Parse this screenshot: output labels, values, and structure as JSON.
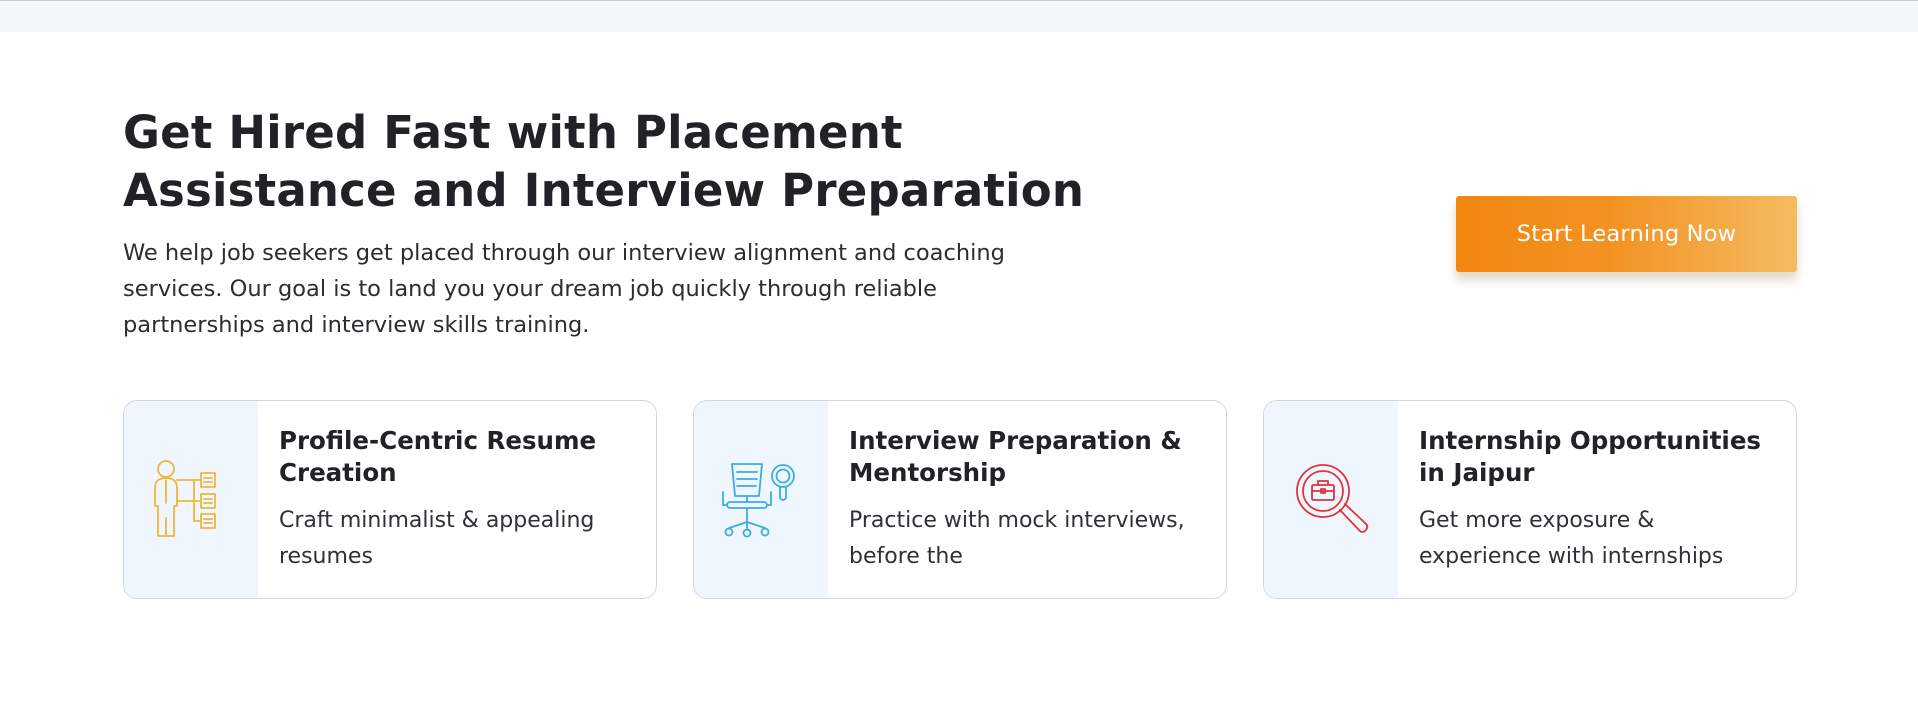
{
  "hero": {
    "title_line1": "Get Hired Fast with Placement",
    "title_line2": "Assistance and Interview Preparation",
    "description": "We help job seekers get placed through our interview alignment and coaching services. Our goal is to land you your dream job quickly through reliable partnerships and interview skills training."
  },
  "cta": {
    "label": "Start Learning Now",
    "gradient_start": "#f28710",
    "gradient_end": "#f4bb61"
  },
  "cards": [
    {
      "title": "Profile-Centric Resume Creation",
      "description": "Craft minimalist & appealing resumes",
      "icon": "resume-profile-icon",
      "icon_color": "#f0b63a"
    },
    {
      "title": "Interview Preparation & Mentorship",
      "description": "Practice with mock interviews, before the",
      "icon": "interview-chair-icon",
      "icon_color": "#3aaedf"
    },
    {
      "title": "Internship Opportunities in Jaipur",
      "description": "Get more exposure & experience with internships",
      "icon": "briefcase-search-icon",
      "icon_color": "#e0333a"
    }
  ],
  "colors": {
    "top_band": "#f3f8fd",
    "card_icon_panel": "#eff6fd",
    "card_border": "#d3d7dd",
    "text": "#202226"
  }
}
